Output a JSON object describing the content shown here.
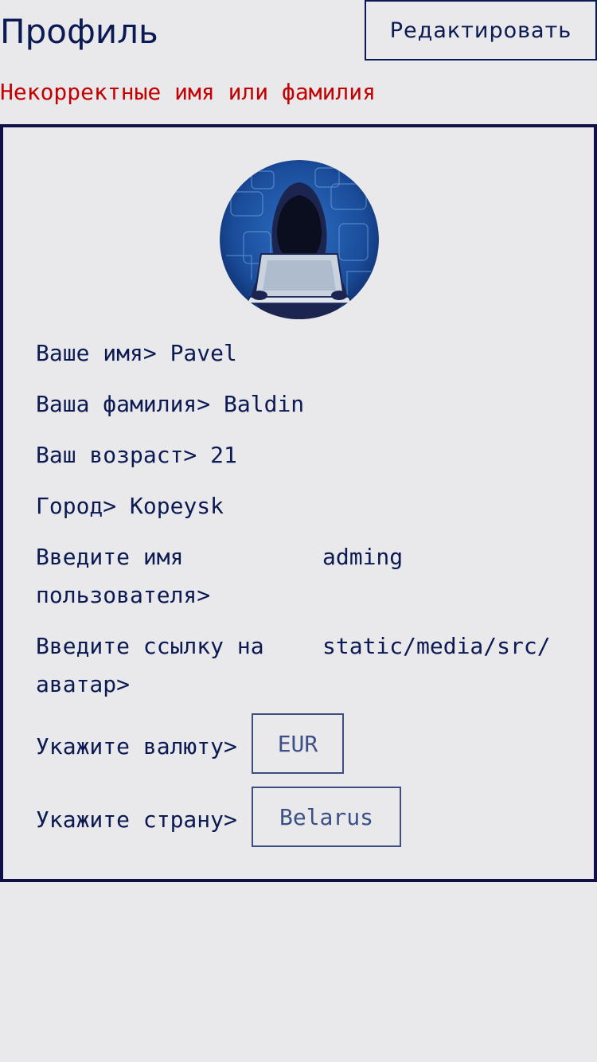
{
  "header": {
    "title": "Профиль",
    "edit_label": "Редактировать"
  },
  "error": "Некорректные имя или фамилия",
  "profile": {
    "avatar_icon": "hooded-hacker-avatar",
    "name_label": "Ваше имя>",
    "name_value": "Pavel",
    "surname_label": "Ваша фамилия>",
    "surname_value": "Baldin",
    "age_label": "Ваш возраст>",
    "age_value": "21",
    "city_label": "Город>",
    "city_value": "Kopeysk",
    "username_label": "Введите имя пользователя>",
    "username_value": "adming",
    "avatar_url_label": "Введите ссылку на аватар>",
    "avatar_url_value": "static/media/src/",
    "currency_label": "Укажите валюту>",
    "currency_value": "EUR",
    "country_label": "Укажите страну>",
    "country_value": "Belarus"
  },
  "colors": {
    "background": "#e9e8eb",
    "text": "#0b1a52",
    "error": "#c40000",
    "card_border": "#12104a"
  }
}
